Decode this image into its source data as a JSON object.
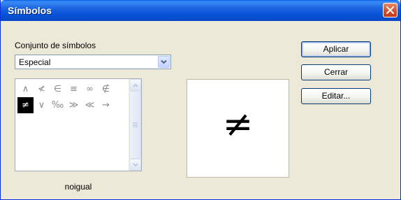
{
  "window": {
    "title": "Símbolos",
    "close_glyph": "✕"
  },
  "symbol_set": {
    "label": "Conjunto de símbolos",
    "selected": "Especial"
  },
  "symbols": [
    {
      "char": "∧",
      "selected": false
    },
    {
      "char": "≮",
      "selected": false
    },
    {
      "char": "∈",
      "selected": false
    },
    {
      "char": "≡",
      "selected": false
    },
    {
      "char": "∞",
      "selected": false
    },
    {
      "char": "∉",
      "selected": false
    },
    {
      "char": "≠",
      "selected": true
    },
    {
      "char": "∨",
      "selected": false
    },
    {
      "char": "‰",
      "selected": false
    },
    {
      "char": "≫",
      "selected": false
    },
    {
      "char": "≪",
      "selected": false
    },
    {
      "char": "→",
      "selected": false
    }
  ],
  "selected_symbol": {
    "glyph": "≠",
    "name": "noigual"
  },
  "buttons": {
    "apply": "Aplicar",
    "close": "Cerrar",
    "edit": "Editar..."
  },
  "colors": {
    "titlebar": "#0552d4",
    "dialog_bg": "#ece9d8",
    "close_button": "#d8532c",
    "selection": "#000000"
  }
}
